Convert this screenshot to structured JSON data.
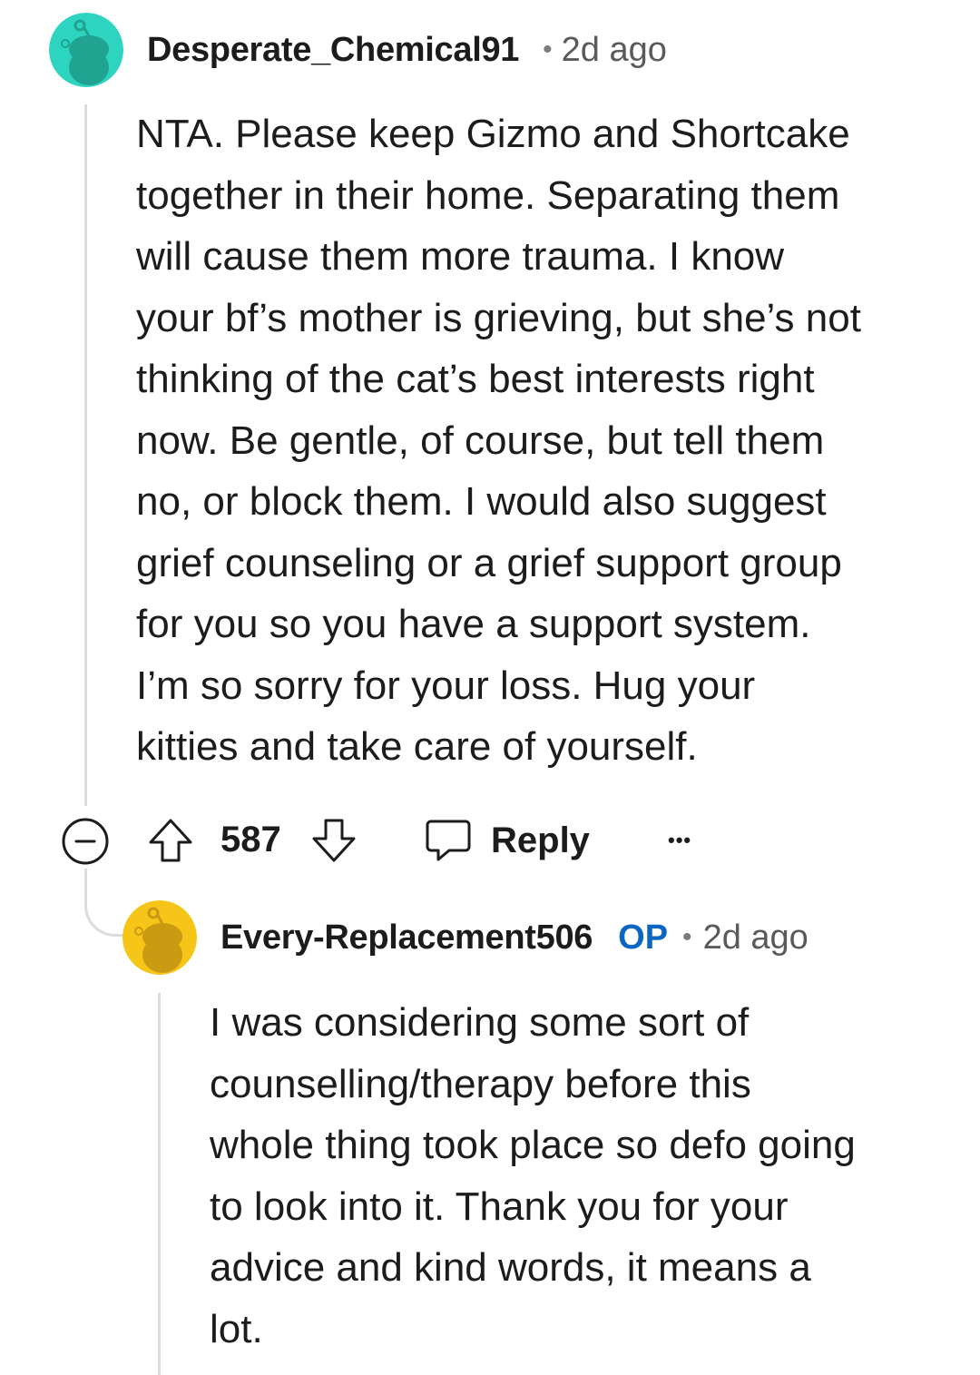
{
  "comment": {
    "username": "Desperate_Chemical91",
    "separator": "•",
    "time": "2d ago",
    "avatar_color": "#2dd4bf",
    "body_lines": [
      "NTA. Please keep Gizmo and Shortcake",
      "together in their home. Separating them",
      "will cause them more trauma. I know",
      "your bf’s mother is grieving, but she’s not",
      "thinking of the cat’s best interests right",
      "now. Be gentle, of course, but tell them",
      "no, or block them. I would also suggest",
      "grief counseling or a grief support group",
      "for you so you have a support system.",
      "I’m so sorry for your loss. Hug your",
      "kitties and take care of yourself."
    ],
    "actions": {
      "collapse_icon": "minus-circle-icon",
      "upvote_icon": "arrow-up-icon",
      "vote_count": "587",
      "downvote_icon": "arrow-down-icon",
      "reply_icon": "speech-bubble-icon",
      "reply_label": "Reply",
      "more_label": "•••"
    }
  },
  "reply": {
    "username": "Every-Replacement506",
    "op_badge": "OP",
    "separator": "•",
    "time": "2d ago",
    "avatar_color": "#f5c518",
    "body_lines": [
      "I was considering some sort of",
      "counselling/therapy before this",
      "whole thing took place so defo going",
      "to look into it. Thank you for your",
      "advice and kind words, it means a",
      "lot."
    ]
  }
}
